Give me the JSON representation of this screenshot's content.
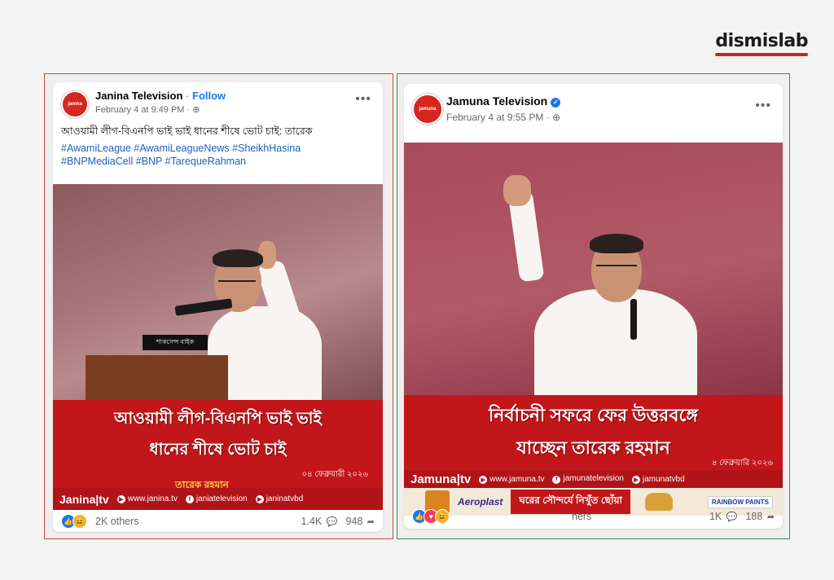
{
  "brand": {
    "logo": "dismislab",
    "accent": "#c62828"
  },
  "left_post": {
    "page_name": "Janina Television",
    "follow_label": "Follow",
    "separator": "·",
    "timestamp": "February 4 at 9:49 PM ·",
    "text": "আওয়ামী লীগ-বিএনপি ভাই ভাই ধানের শীষে ভোট চাই: তারেক",
    "hashtags_line1": "#AwamiLeague #AwamiLeagueNews #SheikhHasina",
    "hashtags_line2": "#BNPMediaCell #BNP #TarequeRahman",
    "headline_line1": "আওয়ামী লীগ-বিএনপি ভাই ভাই",
    "headline_line2": "ধানের শীষে ভোট চাই",
    "date": "০৪ ফেব্রুয়ারী ২০২৬",
    "byline": "তারেক রহমান",
    "podium_sign": "শাকসেন্স বাইক",
    "footer_brand": "Janina|tv",
    "footer_web": "www.janina.tv",
    "footer_fb": "janiatelevision",
    "footer_yt": "janinatvbd",
    "others": "2K others",
    "comments": "1.4K",
    "shares": "948",
    "border_color": "#c74a4a"
  },
  "right_post": {
    "page_name": "Jamuna Television",
    "timestamp": "February 4 at 9:55 PM ·",
    "headline_line1": "নির্বাচনী সফরে ফের উত্তরবঙ্গে",
    "headline_line2": "যাচ্ছেন তারেক রহমান",
    "date": "৪ ফেব্রুয়ারি ২০২৬",
    "footer_brand": "Jamuna|tv",
    "footer_web": "www.jamuna.tv",
    "footer_fb": "jamunatelevision",
    "footer_yt": "jamunatvbd",
    "ad_brand": "Aeroplast",
    "ad_tagline": "ঘরের সৌন্দর্যে নিখুঁত ছোঁয়া",
    "ad_logo": "RAINBOW PAINTS",
    "others": "hers",
    "comments": "1K",
    "shares": "188",
    "border_color": "#3d8a5a"
  }
}
